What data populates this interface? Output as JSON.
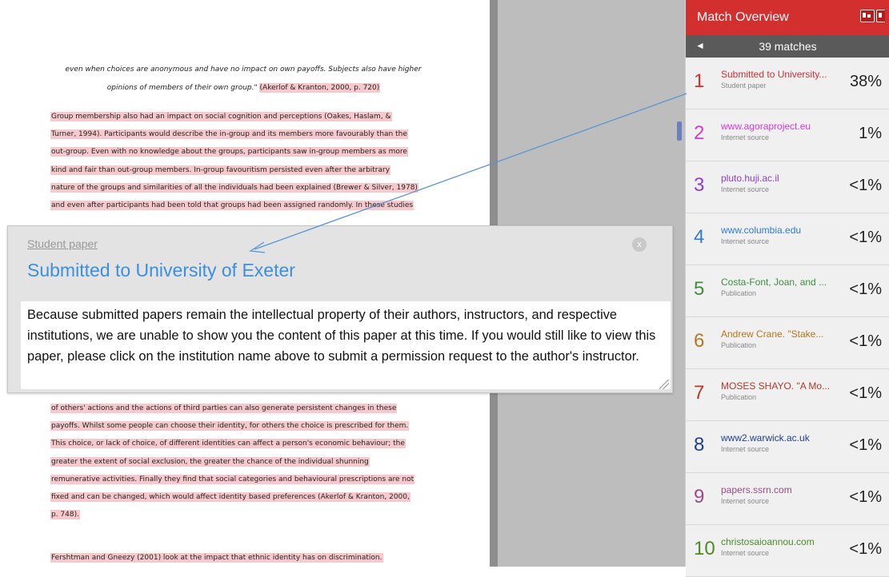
{
  "document": {
    "quote": {
      "line1": "even when choices are anonymous and have no impact on own payoffs. Subjects also have higher",
      "line2_italic": "opinions of members of their own group.\"",
      "line2_cite": "(Akerlof & Kranton, 2000, p. 720)"
    },
    "para1": [
      "Group membership also had an impact on social cognition and perceptions (Oakes, Haslam, &",
      "Turner, 1994). Participants would describe the in-group and its members more favourably than the",
      "out-group. Even with no knowledge about the groups, participants saw in-group members as more",
      "kind and fair than out-group members. In-group favouritism persisted even after the arbitrary",
      "nature of the groups and similarities of all the individuals had been explained (Brewer & Silver, 1978)",
      "and even after participants had been told that groups had been assigned randomly. In these studies"
    ],
    "para2": [
      "of others' actions and the actions of third parties can also generate persistent changes in these",
      "payoffs. Whilst some people can choose their identity, for others the choice is prescribed for them.",
      "This choice, or lack of choice, of different identities can affect a person's economic behaviour; the",
      "greater the extent of social exclusion, the greater the chance of the individual shunning",
      "remunerative activities. Finally they find that social categories and behavioural prescriptions are not",
      "fixed and can be changed, which would affect identity based preferences (Akerlof & Kranton, 2000,",
      "p. 748)."
    ],
    "para3": "Fershtman and Gneezy (2001) look at the impact that ethnic identity has on discrimination."
  },
  "popup": {
    "source_type": "Student paper",
    "title": "Submitted to University of Exeter",
    "close": "x",
    "body": "Because submitted papers remain the intellectual property of their authors, instructors, and respective institutions, we are unable to show you the content of this paper at this time. If you would still like to view this paper, please click on the institution name above to submit a permission request to the author's instructor."
  },
  "panel": {
    "title": "Match Overview",
    "bar_arrow": "◄",
    "matches_label": "39 matches",
    "items": [
      {
        "num": "1",
        "source": "Submitted to University...",
        "type": "Student paper",
        "pct": "38%",
        "color": "#d32f2f"
      },
      {
        "num": "2",
        "source": "www.agoraproject.eu",
        "type": "Internet source",
        "pct": "1%",
        "color": "#d63bd6"
      },
      {
        "num": "3",
        "source": "pluto.huji.ac.il",
        "type": "Internet source",
        "pct": "<1%",
        "color": "#8a3fd1"
      },
      {
        "num": "4",
        "source": "www.columbia.edu",
        "type": "Internet source",
        "pct": "<1%",
        "color": "#2f7bd1"
      },
      {
        "num": "5",
        "source": "Costa-Font, Joan, and ...",
        "type": "Publication",
        "pct": "<1%",
        "color": "#3e8e3e"
      },
      {
        "num": "6",
        "source": "Andrew Crane. \"Stake...",
        "type": "Publication",
        "pct": "<1%",
        "color": "#b5771f"
      },
      {
        "num": "7",
        "source": "MOSES SHAYO. \"A Mo...",
        "type": "Publication",
        "pct": "<1%",
        "color": "#b23a2a"
      },
      {
        "num": "8",
        "source": "www2.warwick.ac.uk",
        "type": "Internet source",
        "pct": "<1%",
        "color": "#1f3f8a"
      },
      {
        "num": "9",
        "source": "papers.ssrn.com",
        "type": "Internet source",
        "pct": "<1%",
        "color": "#9a4a86"
      },
      {
        "num": "10",
        "source": "christosaioannou.com",
        "type": "Internet source",
        "pct": "<1%",
        "color": "#4f8a2a"
      }
    ]
  },
  "colors": {
    "panel_header": "#d32f2f",
    "highlight": "#f7c9cc",
    "link_blue": "#3a8fe0"
  }
}
